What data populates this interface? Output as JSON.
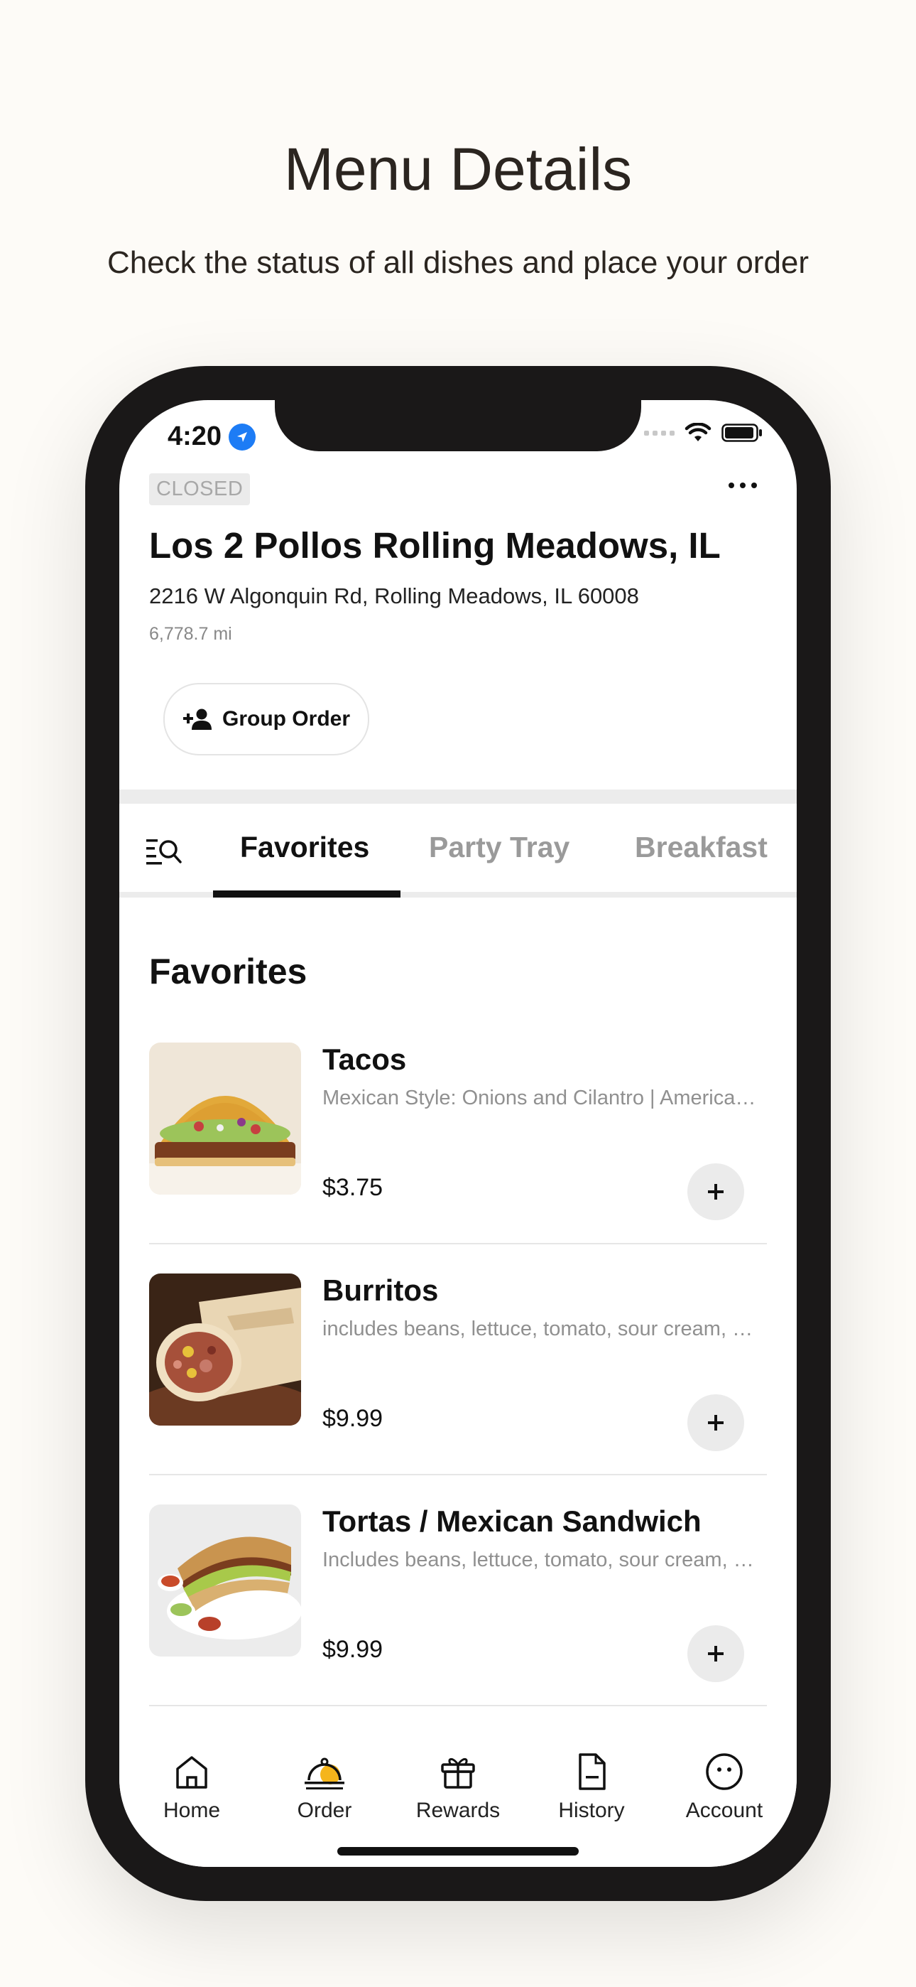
{
  "page": {
    "title": "Menu Details",
    "subtitle": "Check the status of all dishes and place your order"
  },
  "status_bar": {
    "time": "4:20"
  },
  "store": {
    "status": "CLOSED",
    "name": "Los 2 Pollos Rolling Meadows, IL",
    "address": "2216 W Algonquin Rd, Rolling Meadows, IL 60008",
    "distance": "6,778.7 mi",
    "group_order_label": "Group Order"
  },
  "tabs": [
    {
      "label": "Favorites",
      "active": true
    },
    {
      "label": "Party Tray",
      "active": false
    },
    {
      "label": "Breakfast",
      "active": false
    }
  ],
  "section": {
    "title": "Favorites"
  },
  "items": [
    {
      "name": "Tacos",
      "description": "Mexican Style: Onions and Cilantro | American Style",
      "price": "$3.75"
    },
    {
      "name": "Burritos",
      "description": "includes beans, lettuce, tomato, sour cream, cheese",
      "price": "$9.99"
    },
    {
      "name": "Tortas / Mexican Sandwich",
      "description": "Includes beans, lettuce, tomato, sour cream, avocado",
      "price": "$9.99"
    }
  ],
  "tabbar": [
    {
      "label": "Home",
      "icon": "home-icon"
    },
    {
      "label": "Order",
      "icon": "order-cloche-icon"
    },
    {
      "label": "Rewards",
      "icon": "gift-icon"
    },
    {
      "label": "History",
      "icon": "document-icon"
    },
    {
      "label": "Account",
      "icon": "account-icon"
    }
  ],
  "colors": {
    "page_background": "#fdfbf7",
    "phone_frame": "#1a1818",
    "location_badge": "#1d7cf5",
    "order_accent": "#f5b51b"
  }
}
